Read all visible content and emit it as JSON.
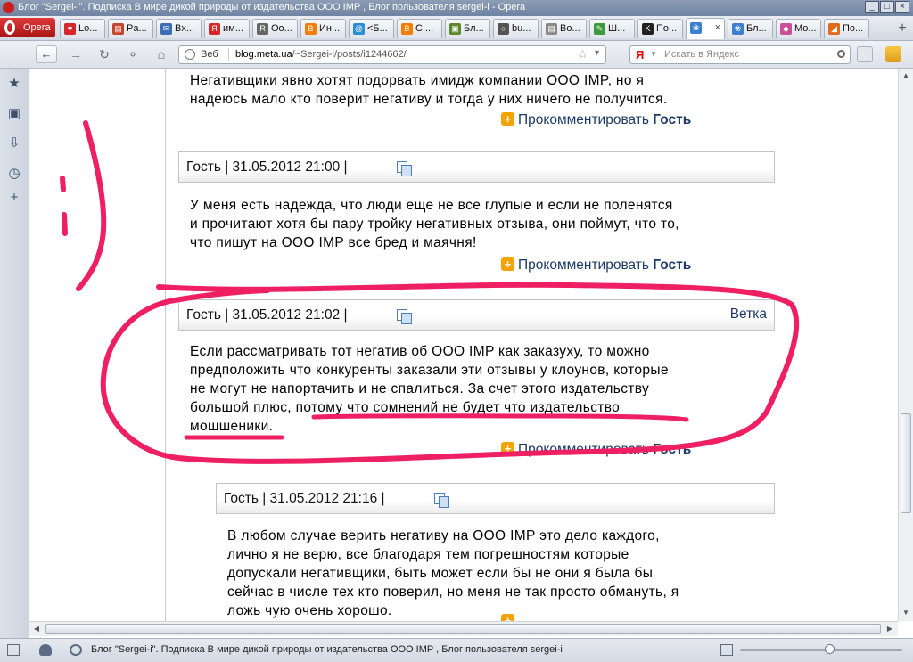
{
  "window": {
    "title": "Блог \"Sergei-i\". Подписка В мире дикой природы от издательства ООО IMP , Блог пользователя sergei-i - Opera"
  },
  "browser": {
    "opera_label": "Opera",
    "tabs": [
      {
        "label": "Lo...",
        "icon": "heart-icon",
        "color": "#d8262b"
      },
      {
        "label": "Pa...",
        "icon": "page-icon",
        "color": "#c4452b"
      },
      {
        "label": "Bx...",
        "icon": "mail-icon",
        "color": "#3c6fb5"
      },
      {
        "label": "им...",
        "icon": "yandex-icon",
        "color": "#d8262b"
      },
      {
        "label": "Oo...",
        "icon": "r-icon",
        "color": "#666666"
      },
      {
        "label": "Ин...",
        "icon": "blogger-icon",
        "color": "#f57d00"
      },
      {
        "label": "<Б...",
        "icon": "at-icon",
        "color": "#2a8fd6"
      },
      {
        "label": "С ...",
        "icon": "blogger-icon",
        "color": "#f57d00"
      },
      {
        "label": "Бл...",
        "icon": "chart-icon",
        "color": "#5a8a2a"
      },
      {
        "label": "bu...",
        "icon": "search-icon",
        "color": "#555555"
      },
      {
        "label": "Во...",
        "icon": "page-icon",
        "color": "#888888"
      },
      {
        "label": "Ш...",
        "icon": "pencil-icon",
        "color": "#3c9a3c"
      },
      {
        "label": "По...",
        "icon": "imp-icon",
        "color": "#222222"
      },
      {
        "label": "",
        "icon": "flower-icon",
        "color": "#3c7fd0"
      },
      {
        "label": "Бл...",
        "icon": "flower-icon",
        "color": "#3c7fd0"
      },
      {
        "label": "Мо...",
        "icon": "puzzle-icon",
        "color": "#c94f9a"
      },
      {
        "label": "По...",
        "icon": "split-icon",
        "color": "#e06a1a"
      }
    ],
    "active_tab_index": 13,
    "address": {
      "web_label": "Веб",
      "url_host": "blog.meta.ua",
      "url_path": "/~Sergei-i/posts/i1244662/"
    },
    "search": {
      "engine": "Я",
      "placeholder": "Искать в Яндекс"
    }
  },
  "comments": {
    "top_partial": {
      "text": "Негативщики явно хотят подорвать имидж компании ООО IMP, но я\nнадеюсь мало кто поверит негативу и тогда у них ничего не получится."
    },
    "reply_label": "Прокомментировать",
    "guest_label": "Гость",
    "items": [
      {
        "author": "Гость",
        "date": "31.05.2012 21:00",
        "text": "У меня есть надежда, что люди еще не все глупые и если не поленятся\nи прочитают хотя бы пару тройку негативных отзыва, они поймут, что то,\nчто пишут на  ООО IMP все бред и маячня!"
      },
      {
        "author": "Гость",
        "date": "31.05.2012 21:02",
        "branch": "Ветка",
        "text": "Если рассматривать тот негатив об ООО IMP как заказуху, то можно\nпредположить что конкуренты заказали эти отзывы у клоунов, которые\nне могут не напортачить и не спалиться. За счет этого издательству\nбольшой плюс, потому что сомнений не будет что издательство\nмошшеники."
      },
      {
        "author": "Гость",
        "date": "31.05.2012 21:16",
        "text": "В любом случае верить негативу на ООО IMP это дело каждого,\nлично я не верю, все благодаря тем погрешностям которые\nдопускали негативщики, быть может если бы не они я была бы\nсейчас в числе тех кто поверил, но меня не так просто обмануть, я\nложь чую очень хорошо."
      }
    ]
  },
  "status": {
    "text": "Блог \"Sergei-i\". Подписка В мире дикой природы от издательства ООО IMP , Блог пользователя sergei-i"
  },
  "colors": {
    "annotation": "#ee1f63",
    "link": "#1d3a66",
    "reply_icon": "#f4a300"
  }
}
